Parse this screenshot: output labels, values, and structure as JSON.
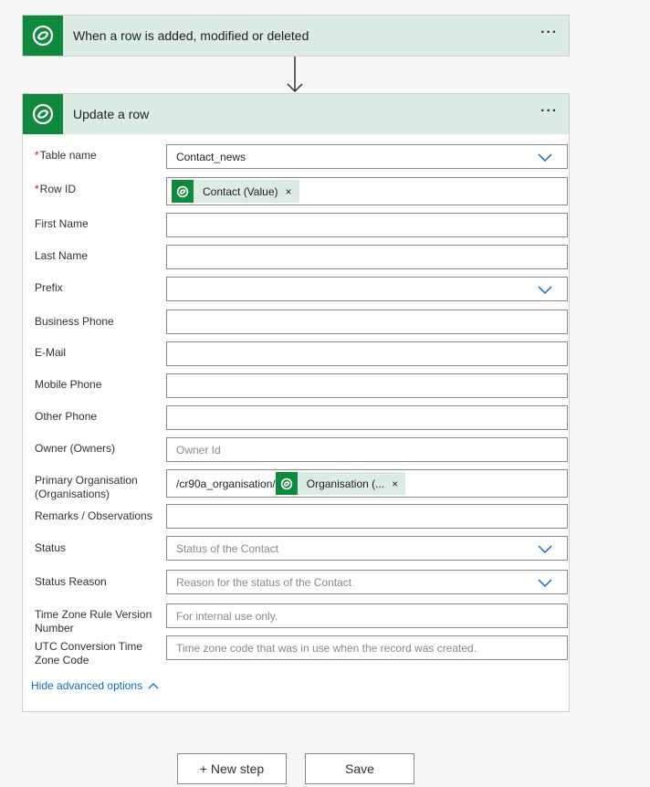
{
  "trigger": {
    "title": "When a row is added, modified or deleted",
    "more": "···",
    "icon": "dataverse-icon"
  },
  "action": {
    "title": "Update a row",
    "more": "···",
    "icon": "dataverse-icon",
    "required_mark": "*",
    "table_name": {
      "label": "Table name",
      "value": "Contact_news"
    },
    "row_id": {
      "label": "Row ID",
      "chip": "Contact (Value)",
      "chip_remove": "×"
    },
    "first_name": {
      "label": "First Name",
      "value": ""
    },
    "last_name": {
      "label": "Last Name",
      "value": ""
    },
    "prefix": {
      "label": "Prefix",
      "value": ""
    },
    "business_phone": {
      "label": "Business Phone",
      "value": ""
    },
    "email": {
      "label": "E-Mail",
      "value": ""
    },
    "mobile_phone": {
      "label": "Mobile Phone",
      "value": ""
    },
    "other_phone": {
      "label": "Other Phone",
      "value": ""
    },
    "owner": {
      "label": "Owner (Owners)",
      "placeholder": "Owner Id"
    },
    "primary_org": {
      "label_line1": "Primary Organisation",
      "label_line2": "(Organisations)",
      "prefix_text": "/cr90a_organisation/",
      "chip": "Organisation (...",
      "chip_remove": "×"
    },
    "remarks": {
      "label": "Remarks / Observations",
      "value": ""
    },
    "status": {
      "label": "Status",
      "placeholder": "Status of the Contact"
    },
    "status_reason": {
      "label": "Status Reason",
      "placeholder": "Reason for the status of the Contact"
    },
    "tz_rule": {
      "label_line1": "Time Zone Rule Version",
      "label_line2": "Number",
      "placeholder": "For internal use only."
    },
    "utc_conv": {
      "label_line1": "UTC Conversion Time",
      "label_line2": "Zone Code",
      "placeholder": "Time zone code that was in use when the record was created."
    },
    "advanced_toggle": "Hide advanced options"
  },
  "footer": {
    "new_step": "+ New step",
    "save": "Save"
  },
  "colors": {
    "brand": "#10893e",
    "header_bg": "#dcebe4",
    "link": "#0f6cbd",
    "required": "#a4262c"
  }
}
